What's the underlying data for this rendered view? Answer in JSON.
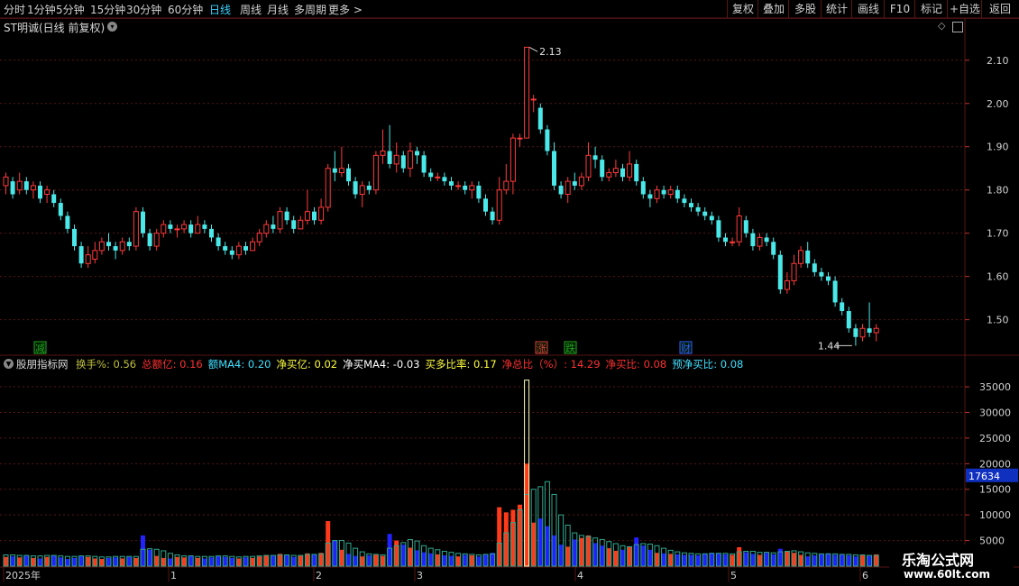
{
  "toolbar": {
    "periods": [
      "分时",
      "1分钟",
      "5分钟",
      "15分钟",
      "30分钟",
      "60分钟",
      "日线",
      "周线",
      "月线",
      "多周期",
      "更多 >"
    ],
    "active_period": "日线",
    "right_buttons": [
      "复权",
      "叠加",
      "多股",
      "统计",
      "画线",
      "F10",
      "标记",
      "+自选",
      "返回"
    ]
  },
  "stock_title": "ST明诚(日线 前复权)",
  "price_axis": {
    "ticks": [
      "2.10",
      "2.00",
      "1.90",
      "1.80",
      "1.70",
      "1.60",
      "1.50"
    ],
    "min": 1.42,
    "max": 2.16
  },
  "price_annotations": {
    "high": "2.13",
    "low": "1.44"
  },
  "event_tags": [
    {
      "text": "减",
      "color": "#22aa22"
    },
    {
      "text": "涨",
      "color": "#e04040"
    },
    {
      "text": "跌",
      "color": "#22aa22"
    },
    {
      "text": "财",
      "color": "#3060ff"
    }
  ],
  "indicator": {
    "name": "股朋指标网",
    "items": [
      {
        "label": "换手%",
        "value": "0.56",
        "color": "#c0c040"
      },
      {
        "label": "总额亿",
        "value": "0.16",
        "color": "#ff3030"
      },
      {
        "label": "额MA4",
        "value": "0.20",
        "color": "#40e0ff"
      },
      {
        "label": "净买亿",
        "value": "0.02",
        "color": "#ffff40"
      },
      {
        "label": "净买MA4",
        "value": "-0.03",
        "color": "#ffffff"
      },
      {
        "label": "买多比率",
        "value": "0.17",
        "color": "#ffff40"
      },
      {
        "label": "净总比（%）",
        "value": "14.29",
        "color": "#ff3030"
      },
      {
        "label": "净买比",
        "value": "0.08",
        "color": "#ff3030"
      },
      {
        "label": "预净买比",
        "value": "0.08",
        "color": "#40e0ff"
      }
    ]
  },
  "volume_axis": {
    "ticks": [
      "35000",
      "30000",
      "25000",
      "20000",
      "15000",
      "10000",
      "5000"
    ],
    "max": 38000,
    "current_label": "17634"
  },
  "date_axis": {
    "labels": [
      "2025年",
      "1",
      "2",
      "3",
      "4",
      "5",
      "6"
    ]
  },
  "logo": {
    "title": "乐淘公式网",
    "url": "www.60lt.com"
  },
  "colors": {
    "up": "#ff3a3a",
    "down": "#4ae8e8",
    "vol_up": "#ff3a1a",
    "vol_down": "#2222ff",
    "grid": "#5a1515"
  },
  "chart_data": {
    "type": "candlestick",
    "series": [
      {
        "name": "K线",
        "values": [
          [
            1.81,
            1.83,
            1.84,
            1.79
          ],
          [
            1.82,
            1.79,
            1.83,
            1.78
          ],
          [
            1.8,
            1.82,
            1.84,
            1.79
          ],
          [
            1.82,
            1.8,
            1.83,
            1.79
          ],
          [
            1.8,
            1.81,
            1.82,
            1.78
          ],
          [
            1.81,
            1.78,
            1.82,
            1.77
          ],
          [
            1.79,
            1.8,
            1.81,
            1.77
          ],
          [
            1.79,
            1.77,
            1.8,
            1.76
          ],
          [
            1.77,
            1.74,
            1.78,
            1.73
          ],
          [
            1.74,
            1.71,
            1.75,
            1.7
          ],
          [
            1.71,
            1.67,
            1.72,
            1.66
          ],
          [
            1.67,
            1.63,
            1.68,
            1.62
          ],
          [
            1.63,
            1.65,
            1.67,
            1.62
          ],
          [
            1.64,
            1.66,
            1.68,
            1.63
          ],
          [
            1.66,
            1.68,
            1.69,
            1.65
          ],
          [
            1.68,
            1.67,
            1.7,
            1.66
          ],
          [
            1.67,
            1.66,
            1.68,
            1.64
          ],
          [
            1.66,
            1.68,
            1.69,
            1.65
          ],
          [
            1.68,
            1.67,
            1.69,
            1.66
          ],
          [
            1.67,
            1.75,
            1.76,
            1.66
          ],
          [
            1.75,
            1.7,
            1.76,
            1.69
          ],
          [
            1.7,
            1.67,
            1.71,
            1.66
          ],
          [
            1.67,
            1.7,
            1.71,
            1.66
          ],
          [
            1.7,
            1.72,
            1.73,
            1.69
          ],
          [
            1.72,
            1.71,
            1.73,
            1.7
          ],
          [
            1.71,
            1.71,
            1.72,
            1.69
          ],
          [
            1.71,
            1.72,
            1.73,
            1.7
          ],
          [
            1.72,
            1.7,
            1.73,
            1.69
          ],
          [
            1.7,
            1.72,
            1.74,
            1.7
          ],
          [
            1.72,
            1.71,
            1.73,
            1.7
          ],
          [
            1.71,
            1.69,
            1.72,
            1.68
          ],
          [
            1.69,
            1.67,
            1.7,
            1.66
          ],
          [
            1.67,
            1.66,
            1.68,
            1.65
          ],
          [
            1.66,
            1.65,
            1.67,
            1.64
          ],
          [
            1.65,
            1.67,
            1.68,
            1.64
          ],
          [
            1.67,
            1.66,
            1.68,
            1.65
          ],
          [
            1.66,
            1.68,
            1.69,
            1.66
          ],
          [
            1.68,
            1.7,
            1.71,
            1.67
          ],
          [
            1.7,
            1.72,
            1.73,
            1.69
          ],
          [
            1.72,
            1.71,
            1.74,
            1.7
          ],
          [
            1.71,
            1.75,
            1.76,
            1.7
          ],
          [
            1.75,
            1.73,
            1.76,
            1.72
          ],
          [
            1.73,
            1.71,
            1.74,
            1.7
          ],
          [
            1.71,
            1.73,
            1.74,
            1.71
          ],
          [
            1.73,
            1.75,
            1.8,
            1.72
          ],
          [
            1.75,
            1.73,
            1.76,
            1.72
          ],
          [
            1.73,
            1.76,
            1.78,
            1.72
          ],
          [
            1.76,
            1.85,
            1.86,
            1.75
          ],
          [
            1.85,
            1.84,
            1.89,
            1.82
          ],
          [
            1.84,
            1.85,
            1.9,
            1.83
          ],
          [
            1.85,
            1.82,
            1.86,
            1.81
          ],
          [
            1.82,
            1.79,
            1.83,
            1.78
          ],
          [
            1.79,
            1.81,
            1.82,
            1.76
          ],
          [
            1.81,
            1.8,
            1.82,
            1.79
          ],
          [
            1.8,
            1.88,
            1.89,
            1.79
          ],
          [
            1.88,
            1.89,
            1.94,
            1.86
          ],
          [
            1.89,
            1.86,
            1.95,
            1.85
          ],
          [
            1.86,
            1.88,
            1.91,
            1.84
          ],
          [
            1.88,
            1.85,
            1.89,
            1.84
          ],
          [
            1.85,
            1.89,
            1.91,
            1.83
          ],
          [
            1.89,
            1.88,
            1.9,
            1.86
          ],
          [
            1.88,
            1.84,
            1.89,
            1.83
          ],
          [
            1.84,
            1.83,
            1.85,
            1.82
          ],
          [
            1.83,
            1.83,
            1.84,
            1.82
          ],
          [
            1.83,
            1.82,
            1.84,
            1.81
          ],
          [
            1.82,
            1.81,
            1.83,
            1.8
          ],
          [
            1.81,
            1.81,
            1.82,
            1.8
          ],
          [
            1.81,
            1.8,
            1.82,
            1.79
          ],
          [
            1.8,
            1.81,
            1.82,
            1.78
          ],
          [
            1.81,
            1.78,
            1.82,
            1.77
          ],
          [
            1.78,
            1.75,
            1.79,
            1.74
          ],
          [
            1.75,
            1.73,
            1.76,
            1.72
          ],
          [
            1.73,
            1.8,
            1.83,
            1.72
          ],
          [
            1.8,
            1.82,
            1.86,
            1.79
          ],
          [
            1.82,
            1.92,
            1.93,
            1.79
          ],
          [
            1.92,
            1.92,
            1.93,
            1.9
          ],
          [
            1.92,
            2.13,
            2.13,
            1.92
          ],
          [
            2.01,
            2.01,
            2.02,
            1.98
          ],
          [
            1.99,
            1.94,
            2.0,
            1.93
          ],
          [
            1.94,
            1.89,
            1.95,
            1.88
          ],
          [
            1.89,
            1.81,
            1.91,
            1.8
          ],
          [
            1.81,
            1.79,
            1.82,
            1.78
          ],
          [
            1.79,
            1.82,
            1.83,
            1.77
          ],
          [
            1.82,
            1.81,
            1.84,
            1.8
          ],
          [
            1.81,
            1.83,
            1.84,
            1.8
          ],
          [
            1.83,
            1.88,
            1.91,
            1.82
          ],
          [
            1.88,
            1.87,
            1.9,
            1.85
          ],
          [
            1.87,
            1.83,
            1.88,
            1.82
          ],
          [
            1.83,
            1.84,
            1.85,
            1.82
          ],
          [
            1.84,
            1.85,
            1.87,
            1.83
          ],
          [
            1.85,
            1.83,
            1.86,
            1.82
          ],
          [
            1.83,
            1.86,
            1.89,
            1.82
          ],
          [
            1.86,
            1.82,
            1.87,
            1.81
          ],
          [
            1.82,
            1.79,
            1.83,
            1.78
          ],
          [
            1.79,
            1.78,
            1.8,
            1.76
          ],
          [
            1.78,
            1.8,
            1.81,
            1.77
          ],
          [
            1.8,
            1.79,
            1.81,
            1.78
          ],
          [
            1.79,
            1.8,
            1.81,
            1.78
          ],
          [
            1.8,
            1.78,
            1.81,
            1.77
          ],
          [
            1.78,
            1.77,
            1.79,
            1.76
          ],
          [
            1.77,
            1.76,
            1.78,
            1.75
          ],
          [
            1.76,
            1.75,
            1.77,
            1.74
          ],
          [
            1.75,
            1.74,
            1.76,
            1.73
          ],
          [
            1.74,
            1.73,
            1.75,
            1.72
          ],
          [
            1.73,
            1.69,
            1.74,
            1.68
          ],
          [
            1.69,
            1.68,
            1.7,
            1.67
          ],
          [
            1.68,
            1.68,
            1.69,
            1.67
          ],
          [
            1.68,
            1.74,
            1.76,
            1.67
          ],
          [
            1.73,
            1.7,
            1.74,
            1.69
          ],
          [
            1.7,
            1.67,
            1.71,
            1.66
          ],
          [
            1.67,
            1.69,
            1.7,
            1.66
          ],
          [
            1.69,
            1.68,
            1.7,
            1.67
          ],
          [
            1.68,
            1.65,
            1.69,
            1.64
          ],
          [
            1.65,
            1.57,
            1.66,
            1.56
          ],
          [
            1.57,
            1.59,
            1.61,
            1.56
          ],
          [
            1.59,
            1.63,
            1.65,
            1.58
          ],
          [
            1.63,
            1.66,
            1.67,
            1.62
          ],
          [
            1.66,
            1.63,
            1.68,
            1.62
          ],
          [
            1.63,
            1.61,
            1.64,
            1.6
          ],
          [
            1.61,
            1.6,
            1.62,
            1.59
          ],
          [
            1.6,
            1.59,
            1.61,
            1.58
          ],
          [
            1.59,
            1.54,
            1.6,
            1.53
          ],
          [
            1.54,
            1.52,
            1.55,
            1.51
          ],
          [
            1.52,
            1.48,
            1.53,
            1.47
          ],
          [
            1.48,
            1.46,
            1.49,
            1.44
          ],
          [
            1.46,
            1.48,
            1.49,
            1.45
          ],
          [
            1.48,
            1.47,
            1.54,
            1.46
          ],
          [
            1.47,
            1.48,
            1.49,
            1.45
          ]
        ]
      },
      {
        "name": "成交量",
        "values": [
          1800,
          1900,
          1700,
          2000,
          1600,
          1500,
          1800,
          2100,
          1700,
          1400,
          1600,
          2000,
          1800,
          1500,
          1400,
          1600,
          1700,
          1500,
          1800,
          1600,
          6000,
          3200,
          2000,
          1600,
          1500,
          1800,
          1700,
          2100,
          1600,
          1500,
          1700,
          2000,
          1800,
          1600,
          1500,
          1700,
          1600,
          1900,
          2200,
          2000,
          2400,
          2100,
          1800,
          2000,
          2500,
          2300,
          2600,
          8800,
          5000,
          3200,
          2400,
          2000,
          1900,
          2100,
          2200,
          2000,
          6300,
          5000,
          4200,
          3600,
          3100,
          2700,
          2500,
          2300,
          2100,
          2000,
          1900,
          2200,
          2100,
          1900,
          2300,
          2600,
          11500,
          10500,
          11000,
          12000,
          20000,
          8500,
          9300,
          7800,
          6000,
          4200,
          3800,
          5200,
          5500,
          6000,
          4500,
          4000,
          3500,
          3000,
          3200,
          3800,
          5600,
          4000,
          3200,
          2600,
          2500,
          2400,
          2300,
          2200,
          2200,
          2100,
          2500,
          2600,
          2500,
          2300,
          2200,
          3700,
          2700,
          2400,
          2200,
          2600,
          2300,
          3400,
          2900,
          2600,
          2200,
          1900,
          2100,
          2300,
          2500,
          2200,
          2200,
          2100,
          1900,
          2100,
          2000,
          2300
        ]
      },
      {
        "name": "量能均线",
        "values": [
          2200,
          2200,
          2100,
          2100,
          2000,
          2000,
          2100,
          2100,
          2000,
          1900,
          1900,
          2000,
          2000,
          1900,
          1800,
          1800,
          1900,
          1900,
          1900,
          1900,
          3300,
          3400,
          3300,
          3000,
          2500,
          2200,
          2000,
          2000,
          1900,
          1900,
          1900,
          2000,
          2000,
          1900,
          1800,
          1900,
          1900,
          2000,
          2100,
          2100,
          2200,
          2200,
          2100,
          2100,
          2300,
          2300,
          2400,
          4500,
          5000,
          5000,
          4500,
          3500,
          2800,
          2400,
          2300,
          2200,
          3500,
          4000,
          4600,
          5200,
          4900,
          4000,
          3500,
          3200,
          2900,
          2700,
          2500,
          2400,
          2300,
          2200,
          2300,
          2400,
          4500,
          6500,
          8500,
          11000,
          14000,
          15000,
          15500,
          16500,
          14000,
          10000,
          8000,
          6500,
          6000,
          5800,
          5500,
          5200,
          4800,
          4400,
          4000,
          3800,
          4200,
          4400,
          4300,
          4000,
          3500,
          3100,
          2800,
          2600,
          2500,
          2400,
          2400,
          2500,
          2500,
          2500,
          2400,
          2800,
          2900,
          2900,
          2700,
          2700,
          2600,
          2800,
          2900,
          3000,
          2800,
          2600,
          2500,
          2400,
          2400,
          2400,
          2300,
          2300,
          2200,
          2200,
          2100,
          2100
        ]
      }
    ],
    "volume_ylim": [
      0,
      38000
    ],
    "price_ylim": [
      1.42,
      2.16
    ],
    "legend": "none",
    "grid": true
  }
}
